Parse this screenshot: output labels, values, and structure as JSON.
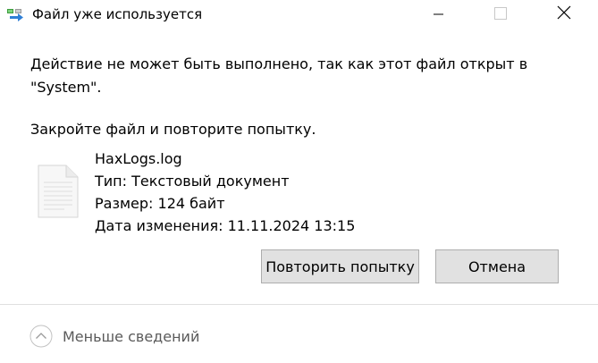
{
  "window": {
    "title": "Файл уже используется"
  },
  "message": {
    "line1": "Действие не может быть выполнено, так как этот файл открыт в",
    "line2": "\"System\".",
    "line3": "Закройте файл и повторите попытку."
  },
  "file": {
    "name": "HaxLogs.log",
    "type": "Тип: Текстовый документ",
    "size": "Размер: 124 байт",
    "modified": "Дата изменения: 11.11.2024 13:15"
  },
  "buttons": {
    "retry_label": "Повторить попытку",
    "cancel_label": "Отмена"
  },
  "footer": {
    "details_label": "Меньше сведений"
  },
  "icons": {
    "title": "file-move-icon",
    "file": "text-document-icon",
    "details": "chevron-up-circle-icon"
  },
  "colors": {
    "button_bg": "#e1e1e1",
    "button_border": "#adadad",
    "footer_text": "#5a5a5a"
  }
}
